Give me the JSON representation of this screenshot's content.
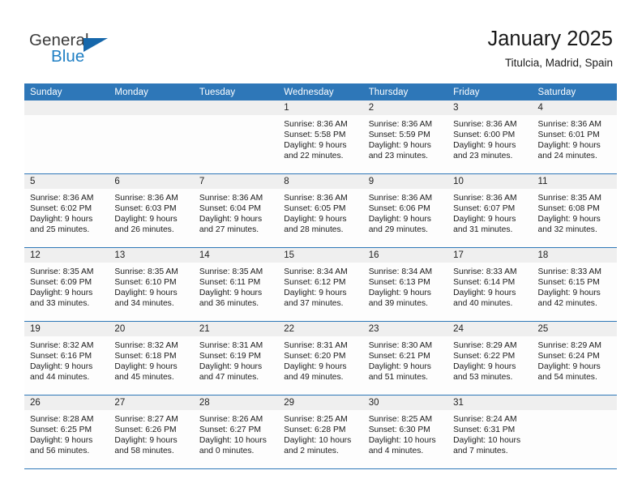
{
  "brand": {
    "name_part1": "General",
    "name_part2": "Blue",
    "triangle_icon": "triangle-logo-icon",
    "accent_color": "#1667ab",
    "blue_text_color": "#1f7fc4"
  },
  "header": {
    "title": "January 2025",
    "subtitle": "Titulcia, Madrid, Spain"
  },
  "theme": {
    "header_row_bg": "#2e77b8",
    "daynum_band_bg": "#efefef",
    "week_divider": "#2e77b8"
  },
  "weekday_headers": [
    "Sunday",
    "Monday",
    "Tuesday",
    "Wednesday",
    "Thursday",
    "Friday",
    "Saturday"
  ],
  "labels": {
    "sunrise_prefix": "Sunrise:",
    "sunset_prefix": "Sunset:",
    "daylight_prefix": "Daylight:"
  },
  "weeks": [
    [
      {
        "day": "",
        "empty": true,
        "sunrise": "",
        "sunset": "",
        "daylight_line1": "",
        "daylight_line2": ""
      },
      {
        "day": "",
        "empty": true,
        "sunrise": "",
        "sunset": "",
        "daylight_line1": "",
        "daylight_line2": ""
      },
      {
        "day": "",
        "empty": true,
        "sunrise": "",
        "sunset": "",
        "daylight_line1": "",
        "daylight_line2": ""
      },
      {
        "day": "1",
        "empty": false,
        "sunrise": "Sunrise: 8:36 AM",
        "sunset": "Sunset: 5:58 PM",
        "daylight_line1": "Daylight: 9 hours",
        "daylight_line2": "and 22 minutes."
      },
      {
        "day": "2",
        "empty": false,
        "sunrise": "Sunrise: 8:36 AM",
        "sunset": "Sunset: 5:59 PM",
        "daylight_line1": "Daylight: 9 hours",
        "daylight_line2": "and 23 minutes."
      },
      {
        "day": "3",
        "empty": false,
        "sunrise": "Sunrise: 8:36 AM",
        "sunset": "Sunset: 6:00 PM",
        "daylight_line1": "Daylight: 9 hours",
        "daylight_line2": "and 23 minutes."
      },
      {
        "day": "4",
        "empty": false,
        "sunrise": "Sunrise: 8:36 AM",
        "sunset": "Sunset: 6:01 PM",
        "daylight_line1": "Daylight: 9 hours",
        "daylight_line2": "and 24 minutes."
      }
    ],
    [
      {
        "day": "5",
        "empty": false,
        "sunrise": "Sunrise: 8:36 AM",
        "sunset": "Sunset: 6:02 PM",
        "daylight_line1": "Daylight: 9 hours",
        "daylight_line2": "and 25 minutes."
      },
      {
        "day": "6",
        "empty": false,
        "sunrise": "Sunrise: 8:36 AM",
        "sunset": "Sunset: 6:03 PM",
        "daylight_line1": "Daylight: 9 hours",
        "daylight_line2": "and 26 minutes."
      },
      {
        "day": "7",
        "empty": false,
        "sunrise": "Sunrise: 8:36 AM",
        "sunset": "Sunset: 6:04 PM",
        "daylight_line1": "Daylight: 9 hours",
        "daylight_line2": "and 27 minutes."
      },
      {
        "day": "8",
        "empty": false,
        "sunrise": "Sunrise: 8:36 AM",
        "sunset": "Sunset: 6:05 PM",
        "daylight_line1": "Daylight: 9 hours",
        "daylight_line2": "and 28 minutes."
      },
      {
        "day": "9",
        "empty": false,
        "sunrise": "Sunrise: 8:36 AM",
        "sunset": "Sunset: 6:06 PM",
        "daylight_line1": "Daylight: 9 hours",
        "daylight_line2": "and 29 minutes."
      },
      {
        "day": "10",
        "empty": false,
        "sunrise": "Sunrise: 8:36 AM",
        "sunset": "Sunset: 6:07 PM",
        "daylight_line1": "Daylight: 9 hours",
        "daylight_line2": "and 31 minutes."
      },
      {
        "day": "11",
        "empty": false,
        "sunrise": "Sunrise: 8:35 AM",
        "sunset": "Sunset: 6:08 PM",
        "daylight_line1": "Daylight: 9 hours",
        "daylight_line2": "and 32 minutes."
      }
    ],
    [
      {
        "day": "12",
        "empty": false,
        "sunrise": "Sunrise: 8:35 AM",
        "sunset": "Sunset: 6:09 PM",
        "daylight_line1": "Daylight: 9 hours",
        "daylight_line2": "and 33 minutes."
      },
      {
        "day": "13",
        "empty": false,
        "sunrise": "Sunrise: 8:35 AM",
        "sunset": "Sunset: 6:10 PM",
        "daylight_line1": "Daylight: 9 hours",
        "daylight_line2": "and 34 minutes."
      },
      {
        "day": "14",
        "empty": false,
        "sunrise": "Sunrise: 8:35 AM",
        "sunset": "Sunset: 6:11 PM",
        "daylight_line1": "Daylight: 9 hours",
        "daylight_line2": "and 36 minutes."
      },
      {
        "day": "15",
        "empty": false,
        "sunrise": "Sunrise: 8:34 AM",
        "sunset": "Sunset: 6:12 PM",
        "daylight_line1": "Daylight: 9 hours",
        "daylight_line2": "and 37 minutes."
      },
      {
        "day": "16",
        "empty": false,
        "sunrise": "Sunrise: 8:34 AM",
        "sunset": "Sunset: 6:13 PM",
        "daylight_line1": "Daylight: 9 hours",
        "daylight_line2": "and 39 minutes."
      },
      {
        "day": "17",
        "empty": false,
        "sunrise": "Sunrise: 8:33 AM",
        "sunset": "Sunset: 6:14 PM",
        "daylight_line1": "Daylight: 9 hours",
        "daylight_line2": "and 40 minutes."
      },
      {
        "day": "18",
        "empty": false,
        "sunrise": "Sunrise: 8:33 AM",
        "sunset": "Sunset: 6:15 PM",
        "daylight_line1": "Daylight: 9 hours",
        "daylight_line2": "and 42 minutes."
      }
    ],
    [
      {
        "day": "19",
        "empty": false,
        "sunrise": "Sunrise: 8:32 AM",
        "sunset": "Sunset: 6:16 PM",
        "daylight_line1": "Daylight: 9 hours",
        "daylight_line2": "and 44 minutes."
      },
      {
        "day": "20",
        "empty": false,
        "sunrise": "Sunrise: 8:32 AM",
        "sunset": "Sunset: 6:18 PM",
        "daylight_line1": "Daylight: 9 hours",
        "daylight_line2": "and 45 minutes."
      },
      {
        "day": "21",
        "empty": false,
        "sunrise": "Sunrise: 8:31 AM",
        "sunset": "Sunset: 6:19 PM",
        "daylight_line1": "Daylight: 9 hours",
        "daylight_line2": "and 47 minutes."
      },
      {
        "day": "22",
        "empty": false,
        "sunrise": "Sunrise: 8:31 AM",
        "sunset": "Sunset: 6:20 PM",
        "daylight_line1": "Daylight: 9 hours",
        "daylight_line2": "and 49 minutes."
      },
      {
        "day": "23",
        "empty": false,
        "sunrise": "Sunrise: 8:30 AM",
        "sunset": "Sunset: 6:21 PM",
        "daylight_line1": "Daylight: 9 hours",
        "daylight_line2": "and 51 minutes."
      },
      {
        "day": "24",
        "empty": false,
        "sunrise": "Sunrise: 8:29 AM",
        "sunset": "Sunset: 6:22 PM",
        "daylight_line1": "Daylight: 9 hours",
        "daylight_line2": "and 53 minutes."
      },
      {
        "day": "25",
        "empty": false,
        "sunrise": "Sunrise: 8:29 AM",
        "sunset": "Sunset: 6:24 PM",
        "daylight_line1": "Daylight: 9 hours",
        "daylight_line2": "and 54 minutes."
      }
    ],
    [
      {
        "day": "26",
        "empty": false,
        "sunrise": "Sunrise: 8:28 AM",
        "sunset": "Sunset: 6:25 PM",
        "daylight_line1": "Daylight: 9 hours",
        "daylight_line2": "and 56 minutes."
      },
      {
        "day": "27",
        "empty": false,
        "sunrise": "Sunrise: 8:27 AM",
        "sunset": "Sunset: 6:26 PM",
        "daylight_line1": "Daylight: 9 hours",
        "daylight_line2": "and 58 minutes."
      },
      {
        "day": "28",
        "empty": false,
        "sunrise": "Sunrise: 8:26 AM",
        "sunset": "Sunset: 6:27 PM",
        "daylight_line1": "Daylight: 10 hours",
        "daylight_line2": "and 0 minutes."
      },
      {
        "day": "29",
        "empty": false,
        "sunrise": "Sunrise: 8:25 AM",
        "sunset": "Sunset: 6:28 PM",
        "daylight_line1": "Daylight: 10 hours",
        "daylight_line2": "and 2 minutes."
      },
      {
        "day": "30",
        "empty": false,
        "sunrise": "Sunrise: 8:25 AM",
        "sunset": "Sunset: 6:30 PM",
        "daylight_line1": "Daylight: 10 hours",
        "daylight_line2": "and 4 minutes."
      },
      {
        "day": "31",
        "empty": false,
        "sunrise": "Sunrise: 8:24 AM",
        "sunset": "Sunset: 6:31 PM",
        "daylight_line1": "Daylight: 10 hours",
        "daylight_line2": "and 7 minutes."
      },
      {
        "day": "",
        "empty": true,
        "sunrise": "",
        "sunset": "",
        "daylight_line1": "",
        "daylight_line2": ""
      }
    ]
  ]
}
